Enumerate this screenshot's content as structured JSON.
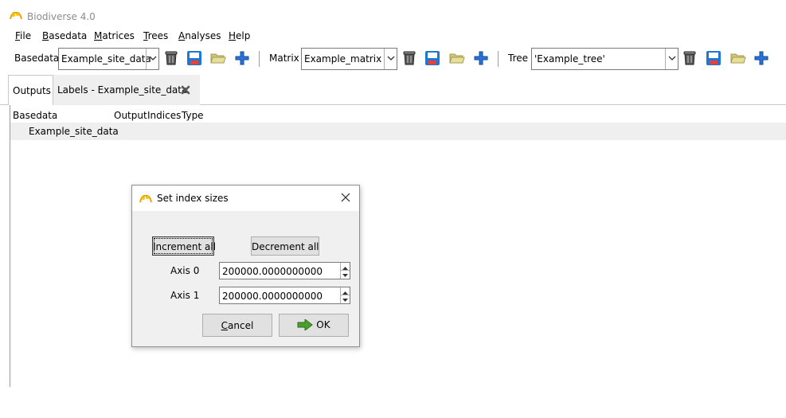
{
  "window": {
    "title": "Biodiverse 4.0",
    "icon": "biodiverse-app-icon"
  },
  "menubar": {
    "items": [
      {
        "label": "File",
        "accel": "F",
        "rest": "ile"
      },
      {
        "label": "Basedata",
        "accel": "B",
        "rest": "asedata"
      },
      {
        "label": "Matrices",
        "accel": "M",
        "rest": "atrices"
      },
      {
        "label": "Trees",
        "accel": "T",
        "rest": "rees"
      },
      {
        "label": "Analyses",
        "accel": "A",
        "rest": "nalyses"
      },
      {
        "label": "Help",
        "accel": "H",
        "rest": "elp"
      }
    ]
  },
  "toolbar": {
    "basedata_label": "Basedata",
    "basedata_value": "Example_site_data",
    "matrix_label": "Matrix",
    "matrix_value": "Example_matrix",
    "tree_label": "Tree",
    "tree_value": "'Example_tree'",
    "icons": [
      "bin-icon",
      "save-icon",
      "open-folder-icon",
      "add-icon"
    ]
  },
  "tabs": [
    {
      "label": "Outputs",
      "active": true
    },
    {
      "label": "Labels - Example_site_data",
      "active": false,
      "closable": true
    }
  ],
  "outputs_table": {
    "columns": [
      "Basedata",
      "Output",
      "Indices",
      "Type"
    ],
    "rows": [
      {
        "basedata": "Example_site_data"
      }
    ]
  },
  "dialog": {
    "title": "Set index sizes",
    "increment_label": "Increment all",
    "decrement_label": "Decrement all",
    "axes": [
      {
        "label": "Axis 0",
        "value": "200000.0000000000"
      },
      {
        "label": "Axis 1",
        "value": "200000.0000000000"
      }
    ],
    "cancel_label": "Cancel",
    "cancel_accel": "C",
    "cancel_rest": "ancel",
    "ok_label": "OK"
  },
  "colors": {
    "save_blue": "#1e78d2",
    "plus_blue": "#2a72d8",
    "folder": "#dcd58a",
    "ok_green": "#4aa02c"
  }
}
